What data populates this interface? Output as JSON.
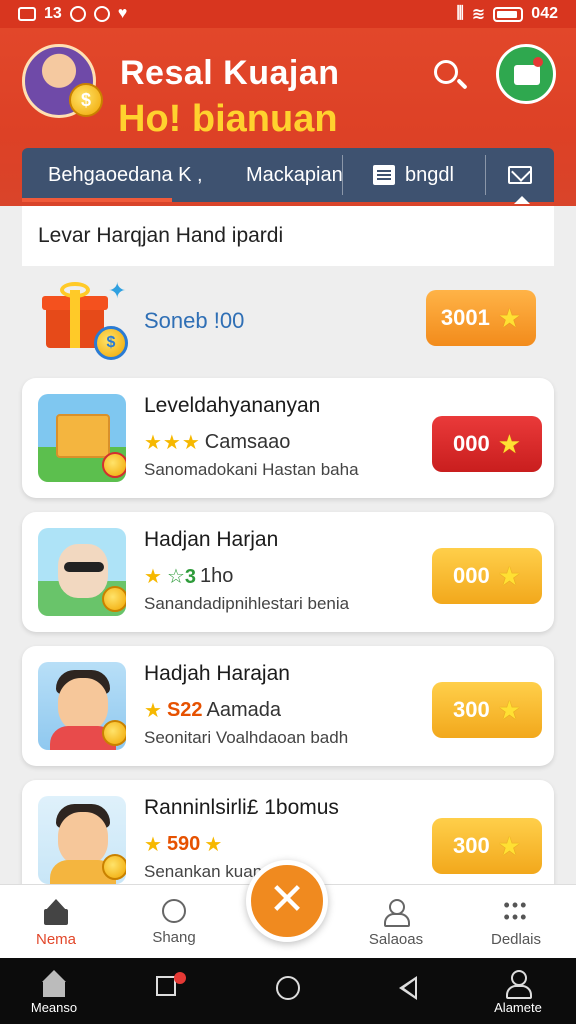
{
  "status_bar": {
    "left_text": "13",
    "right_text": "042"
  },
  "header": {
    "title": "Resal Kuajan",
    "subtitle": "Ho! bianuan",
    "avatar_icon": "user-avatar-coin",
    "search_icon": "search-icon",
    "action_icon": "wallet-icon"
  },
  "tabs": [
    {
      "label": "Behgaoedana K ,"
    },
    {
      "label": "Mackapian"
    },
    {
      "label": "bngdl",
      "icon": "document-icon"
    },
    {
      "label": "",
      "icon": "mail-icon"
    }
  ],
  "section_heading": "Levar Harqjan Hand ipardi",
  "promo": {
    "text": "Soneb !00",
    "reward": "3001",
    "icon": "gift-box-icon"
  },
  "cards": [
    {
      "title": "Leveldahyananyan",
      "stars": "★★★",
      "rating_text": "Camsaao",
      "subtitle": "Sanomadokani Hastan baha",
      "reward": "000",
      "reward_color": "#d32f2f"
    },
    {
      "title": "Hadjan Harjan",
      "stars": "★",
      "rating_prefix": "☆3",
      "rating_text": "1ho",
      "subtitle": "Sanandadipnihlestari benia",
      "reward": "000",
      "reward_color": "#f2a81c"
    },
    {
      "title": "Hadjah Harajan",
      "stars": "★",
      "rating_prefix": "S22",
      "rating_text": "Aamada",
      "subtitle": "Seonitari Voalhdaoan badh",
      "reward": "300",
      "reward_color": "#f2a81c"
    },
    {
      "title": "Ranninlsirli£ 1bomus",
      "stars": "★",
      "rating_prefix": "590",
      "rating_text": "★",
      "subtitle": "Senankan kuan t... ata",
      "reward": "300",
      "reward_color": "#f2a81c"
    }
  ],
  "bottom_nav": [
    {
      "label": "Nema",
      "icon": "home-icon"
    },
    {
      "label": "Shang",
      "icon": "chat-icon"
    },
    {
      "label": "Salaoas",
      "icon": "user-icon"
    },
    {
      "label": "Dedlais",
      "icon": "more-icon"
    }
  ],
  "fab": {
    "label": "✕",
    "icon": "close-icon"
  },
  "system_nav": [
    {
      "label": "Meanso",
      "icon": "home-icon"
    },
    {
      "label": "",
      "icon": "recent-apps-icon"
    },
    {
      "label": "",
      "icon": "home-circle-icon"
    },
    {
      "label": "",
      "icon": "back-icon"
    },
    {
      "label": "Alamete",
      "icon": "account-icon"
    }
  ],
  "colors": {
    "header_red": "#e2472a",
    "title_yellow": "#ffd22e",
    "tab_bar": "#3e5270",
    "reward_orange": "#f28b1b",
    "reward_red": "#d32f2f",
    "fab_orange": "#f08a1f"
  }
}
